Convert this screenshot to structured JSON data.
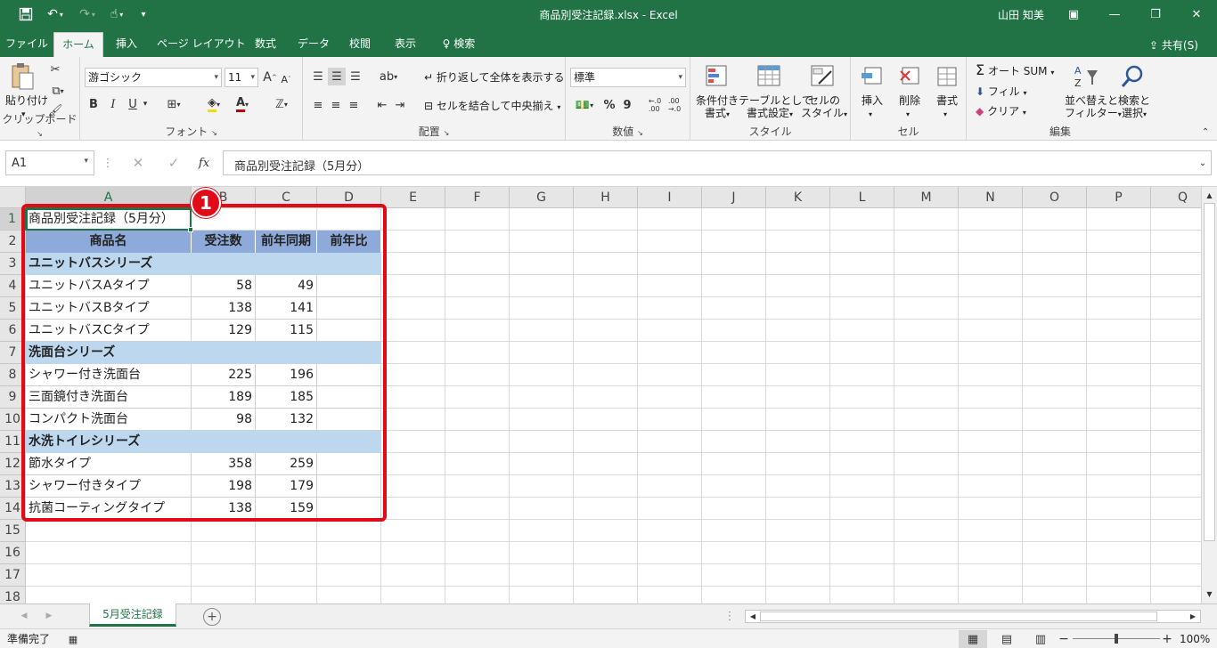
{
  "titlebar": {
    "title": "商品別受注記録.xlsx  -  Excel",
    "user": "山田 知美",
    "save_icon": "save-icon",
    "undo_icon": "undo-icon",
    "redo_icon": "redo-icon",
    "touch_icon": "touch-mode-icon"
  },
  "tabs": [
    "ファイル",
    "ホーム",
    "挿入",
    "ページ レイアウト",
    "数式",
    "データ",
    "校閲",
    "表示"
  ],
  "tell_me": "検索",
  "share": "共有(S)",
  "ribbon": {
    "clipboard": {
      "paste": "貼り付け",
      "label": "クリップボード"
    },
    "font": {
      "name": "游ゴシック",
      "size": "11",
      "bold": "B",
      "italic": "I",
      "underline": "U",
      "label": "フォント",
      "inc": "A",
      "dec": "A",
      "color_a": "A"
    },
    "alignment": {
      "wrap": "折り返して全体を表示する",
      "merge": "セルを結合して中央揃え",
      "label": "配置"
    },
    "number": {
      "format": "標準",
      "percent": "%",
      "comma": "9",
      "label": "数値"
    },
    "styles": {
      "cond": [
        "条件付き",
        "書式"
      ],
      "table": [
        "テーブルとして",
        "書式設定"
      ],
      "cell": [
        "セルの",
        "スタイル"
      ],
      "label": "スタイル"
    },
    "cells": {
      "insert": "挿入",
      "delete": "削除",
      "format": "書式",
      "label": "セル"
    },
    "editing": {
      "autosum": "オート SUM",
      "fill": "フィル",
      "clear": "クリア",
      "sort": [
        "並べ替えと",
        "フィルター"
      ],
      "find": [
        "検索と",
        "選択"
      ],
      "label": "編集"
    }
  },
  "formula_bar": {
    "name_box": "A1",
    "cancel": "✕",
    "enter": "✓",
    "fx": "fx",
    "content": "商品別受注記録（5月分）"
  },
  "columns": [
    "A",
    "B",
    "C",
    "D",
    "E",
    "F",
    "G",
    "H",
    "I",
    "J",
    "K",
    "L",
    "M",
    "N",
    "O",
    "P",
    "Q"
  ],
  "rows": [
    "1",
    "2",
    "3",
    "4",
    "5",
    "6",
    "7",
    "8",
    "9",
    "10",
    "11",
    "12",
    "13",
    "14",
    "15",
    "16",
    "17",
    "18"
  ],
  "sheet": {
    "title": "商品別受注記録（5月分）",
    "headers": [
      "商品名",
      "受注数",
      "前年同期",
      "前年比"
    ],
    "groups": [
      {
        "name": "ユニットバスシリーズ",
        "items": [
          {
            "name": "ユニットバスAタイプ",
            "orders": "58",
            "prev": "49"
          },
          {
            "name": "ユニットバスBタイプ",
            "orders": "138",
            "prev": "141"
          },
          {
            "name": "ユニットバスCタイプ",
            "orders": "129",
            "prev": "115"
          }
        ]
      },
      {
        "name": "洗面台シリーズ",
        "items": [
          {
            "name": "シャワー付き洗面台",
            "orders": "225",
            "prev": "196"
          },
          {
            "name": "三面鏡付き洗面台",
            "orders": "189",
            "prev": "185"
          },
          {
            "name": "コンパクト洗面台",
            "orders": "98",
            "prev": "132"
          }
        ]
      },
      {
        "name": "水洗トイレシリーズ",
        "items": [
          {
            "name": "節水タイプ",
            "orders": "358",
            "prev": "259"
          },
          {
            "name": "シャワー付きタイプ",
            "orders": "198",
            "prev": "179"
          },
          {
            "name": "抗菌コーティングタイプ",
            "orders": "138",
            "prev": "159"
          }
        ]
      }
    ]
  },
  "annotation": {
    "badge": "1"
  },
  "sheet_tab": "5月受注記録",
  "status": {
    "ready": "準備完了",
    "zoom": "100%"
  },
  "colors": {
    "excel_green": "#217346",
    "header_fill": "#8eaadb",
    "category_fill": "#bdd7ee",
    "highlight_red": "#e20a17"
  }
}
